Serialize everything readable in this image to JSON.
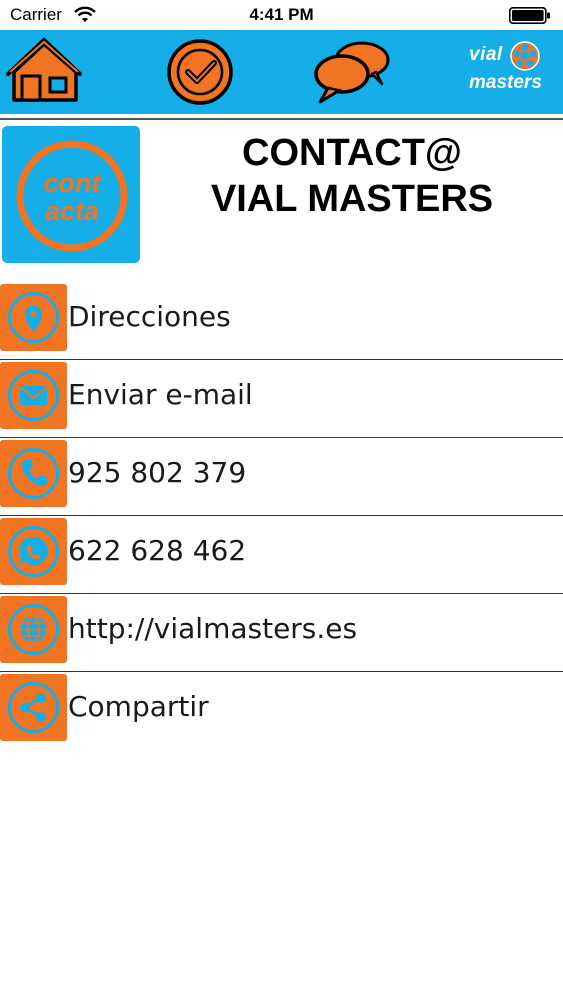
{
  "status_bar": {
    "carrier": "Carrier",
    "time": "4:41 PM"
  },
  "nav": {
    "logo_line1": "vial",
    "logo_line2": "masters"
  },
  "header": {
    "badge_line1": "cont",
    "badge_line2": "acta",
    "title_line1": "CONTACT@",
    "title_line2": "VIAL MASTERS"
  },
  "contacts": [
    {
      "label": "Direcciones",
      "icon": "location-pin-icon"
    },
    {
      "label": "Enviar e-mail",
      "icon": "envelope-icon"
    },
    {
      "label": "925 802 379",
      "icon": "phone-icon"
    },
    {
      "label": "622 628 462",
      "icon": "whatsapp-icon"
    },
    {
      "label": "http://vialmasters.es",
      "icon": "globe-icon"
    },
    {
      "label": "Compartir",
      "icon": "share-icon"
    }
  ],
  "colors": {
    "accent_blue": "#16aee8",
    "accent_orange": "#f07422"
  }
}
